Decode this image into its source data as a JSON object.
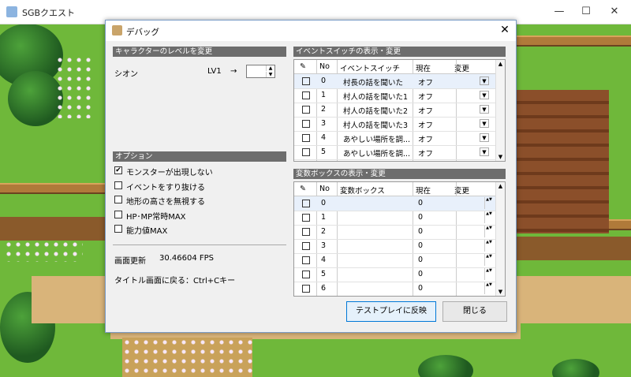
{
  "app": {
    "title": "SGBクエスト",
    "minimize": "—",
    "maximize": "☐",
    "close": "✕"
  },
  "dialog": {
    "title": "デバッグ",
    "close": "✕",
    "level_section": {
      "header": "キャラクターのレベルを変更",
      "character": "シオン",
      "current_level": "LV1",
      "arrow": "→",
      "new_level_value": ""
    },
    "options_section": {
      "header": "オプション",
      "items": [
        {
          "label": "モンスターが出現しない",
          "checked": true
        },
        {
          "label": "イベントをすり抜ける",
          "checked": false
        },
        {
          "label": "地形の高さを無視する",
          "checked": false
        },
        {
          "label": "HP･MP常時MAX",
          "checked": false
        },
        {
          "label": "能力値MAX",
          "checked": false
        }
      ]
    },
    "fps_label": "画面更新",
    "fps_value": "30.46604 FPS",
    "title_hint": "タイトル画面に戻る：Ctrl+Cキー",
    "switch_section": {
      "header": "イベントスイッチの表示・変更",
      "columns": [
        "No",
        "イベントスイッチ",
        "現在",
        "変更"
      ],
      "rows": [
        {
          "no": "0",
          "name": "村長の話を聞いた",
          "value": "オフ"
        },
        {
          "no": "1",
          "name": "村人の話を聞いた1",
          "value": "オフ"
        },
        {
          "no": "2",
          "name": "村人の話を聞いた2",
          "value": "オフ"
        },
        {
          "no": "3",
          "name": "村人の話を聞いた3",
          "value": "オフ"
        },
        {
          "no": "4",
          "name": "あやしい場所を調...",
          "value": "オフ"
        },
        {
          "no": "5",
          "name": "あやしい場所を調...",
          "value": "オフ"
        }
      ]
    },
    "variable_section": {
      "header": "変数ボックスの表示・変更",
      "columns": [
        "No",
        "変数ボックス",
        "現在",
        "変更"
      ],
      "rows": [
        {
          "no": "0",
          "name": "",
          "value": "0"
        },
        {
          "no": "1",
          "name": "",
          "value": "0"
        },
        {
          "no": "2",
          "name": "",
          "value": "0"
        },
        {
          "no": "3",
          "name": "",
          "value": "0"
        },
        {
          "no": "4",
          "name": "",
          "value": "0"
        },
        {
          "no": "5",
          "name": "",
          "value": "0"
        },
        {
          "no": "6",
          "name": "",
          "value": "0"
        }
      ]
    },
    "apply_button": "テストプレイに反映",
    "close_button": "閉じる"
  }
}
